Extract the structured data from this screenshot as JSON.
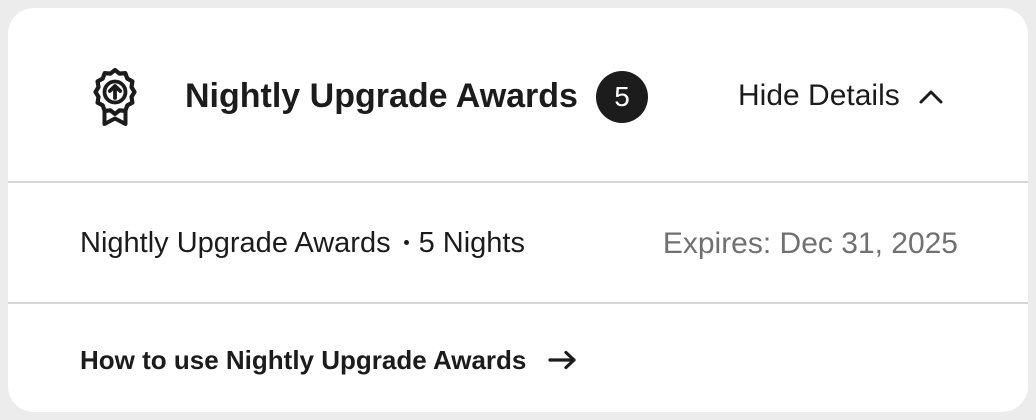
{
  "header": {
    "icon": "award-ribbon-upgrade-icon",
    "title": "Nightly Upgrade Awards",
    "count": "5",
    "toggle_label": "Hide Details",
    "toggle_icon": "chevron-up-icon"
  },
  "detail": {
    "name": "Nightly Upgrade Awards",
    "nights": "5 Nights",
    "expires": "Expires: Dec 31, 2025"
  },
  "link": {
    "label": "How to use Nightly Upgrade Awards",
    "icon": "arrow-right-icon"
  },
  "colors": {
    "text": "#1c1c1c",
    "muted": "#707070",
    "divider": "#d6d6d6",
    "badge_bg": "#1c1c1c",
    "background": "#ececec"
  }
}
